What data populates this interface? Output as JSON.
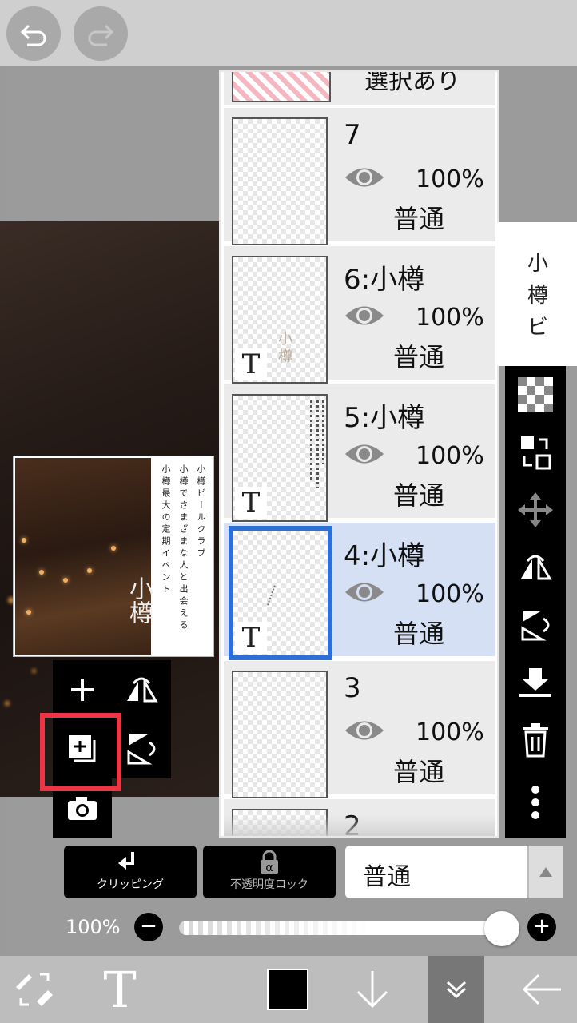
{
  "top_bar": {
    "undo_icon": "undo-icon",
    "redo_icon": "redo-icon"
  },
  "canvas": {
    "poster": {
      "title": "小樽",
      "line1": "小樽ビールクラブ",
      "line2": "小樽でさまざまな人と出会える",
      "line3": "小樽最大の定期イベント"
    }
  },
  "layer_menu": {
    "items": [
      "add-layer-icon",
      "flip-horizontal-icon",
      "add-image-layer-icon",
      "flip-vertical-icon",
      "camera-icon"
    ]
  },
  "layers": {
    "partial_top": "選択あり",
    "items": [
      {
        "name": "7",
        "opacity": "100%",
        "blend": "普通",
        "text_layer": false,
        "selected": false
      },
      {
        "name": "6:小樽",
        "opacity": "100%",
        "blend": "普通",
        "text_layer": true,
        "selected": false
      },
      {
        "name": "5:小樽",
        "opacity": "100%",
        "blend": "普通",
        "text_layer": true,
        "selected": false
      },
      {
        "name": "4:小樽",
        "opacity": "100%",
        "blend": "普通",
        "text_layer": true,
        "selected": true
      },
      {
        "name": "3",
        "opacity": "100%",
        "blend": "普通",
        "text_layer": false,
        "selected": false
      }
    ],
    "partial_bottom": "2",
    "thumb_text_6": "小樽",
    "thumb_badge": "T"
  },
  "right_panel": {
    "text": "小樽ビ"
  },
  "right_toolbar": [
    "transparency-icon",
    "swap-layers-icon",
    "move-icon",
    "flip-horizontal-icon",
    "flip-vertical-icon",
    "merge-down-icon",
    "trash-icon",
    "more-icon"
  ],
  "controls": {
    "clipping_label": "クリッピング",
    "opacity_lock_label": "不透明度ロック",
    "blend_mode": "普通",
    "opacity_value": "100%",
    "opacity_fraction": 1.0
  },
  "bottom_bar": {
    "tools": [
      "brush-eraser-swap-icon",
      "text-tool-icon",
      "color-swatch",
      "down-arrow-icon",
      "collapse-icon",
      "back-icon"
    ],
    "text_tool_glyph": "T",
    "color": "#000000"
  },
  "colors": {
    "selected_layer_bg": "#d6e0f5",
    "selected_border": "#2c6fd6",
    "highlight": "#ef3545"
  }
}
